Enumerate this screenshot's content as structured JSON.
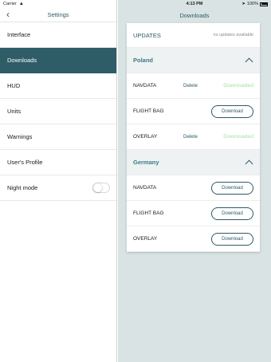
{
  "status_left": {
    "carrier": "Carrier",
    "wifi_icon": "wifi-icon"
  },
  "status_right": {
    "time": "4:13 PM",
    "location_icon": "location-icon",
    "battery": "100%"
  },
  "left": {
    "title": "Settings",
    "back_icon": "chevron-left-icon",
    "items": [
      {
        "label": "Interface"
      },
      {
        "label": "Downloads",
        "active": true
      },
      {
        "label": "HUD"
      },
      {
        "label": "Units"
      },
      {
        "label": "Warnings"
      },
      {
        "label": "User's Profile"
      },
      {
        "label": "Night mode",
        "toggle": false
      }
    ]
  },
  "right": {
    "title": "Downloads",
    "updates": {
      "title": "UPDATES",
      "status": "no updates available"
    },
    "sections": [
      {
        "name": "Poland",
        "items": [
          {
            "name": "NAVDATA",
            "delete": "Delete",
            "status": "Downloaded"
          },
          {
            "name": "FLIGHT BAG",
            "button": "Download"
          },
          {
            "name": "OVERLAY",
            "delete": "Delete",
            "status": "Downloaded"
          }
        ]
      },
      {
        "name": "Germany",
        "items": [
          {
            "name": "NAVDATA",
            "button": "Download"
          },
          {
            "name": "FLIGHT BAG",
            "button": "Download"
          },
          {
            "name": "OVERLAY",
            "button": "Download"
          }
        ]
      }
    ]
  },
  "colors": {
    "accent": "#2e5d68",
    "downloaded": "#a6dfa6",
    "background": "#d9e3e3"
  }
}
